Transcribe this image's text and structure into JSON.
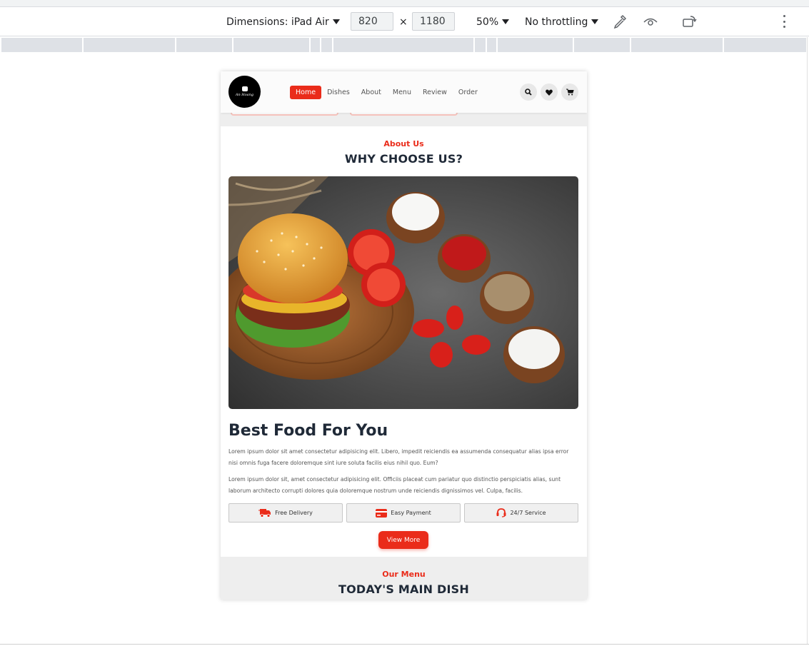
{
  "devtools": {
    "dimensions_label": "Dimensions: iPad Air",
    "width": "820",
    "times": "×",
    "height": "1180",
    "zoom": "50%",
    "throttling": "No throttling"
  },
  "site": {
    "logo_text": "An Hoang",
    "nav": [
      "Home",
      "Dishes",
      "About",
      "Menu",
      "Review",
      "Order"
    ],
    "active_nav": "Home",
    "about": {
      "kicker": "About Us",
      "title": "WHY CHOOSE US?",
      "heading": "Best Food For You",
      "para1": "Lorem ipsum dolor sit amet consectetur adipisicing elit. Libero, impedit reiciendis ea assumenda consequatur alias ipsa error nisi omnis fuga facere doloremque sint iure soluta facilis eius nihil quo. Eum?",
      "para2": "Lorem ipsum dolor sit, amet consectetur adipisicing elit. Officiis placeat cum pariatur quo distinctio perspiciatis alias, sunt laborum architecto corrupti dolores quia doloremque nostrum unde reiciendis dignissimos vel. Culpa, facilis.",
      "features": [
        "Free Delivery",
        "Easy Payment",
        "24/7 Service"
      ],
      "cta": "View More"
    },
    "menu": {
      "kicker": "Our Menu",
      "title": "TODAY'S MAIN DISH"
    }
  },
  "colors": {
    "accent": "#ea2c1a",
    "heading": "#1f2937",
    "toolbar_bg": "#ffffff"
  },
  "icons": [
    "caret-down-icon",
    "eyedropper-icon",
    "eye-icon",
    "rotate-icon",
    "more-vert-icon",
    "search-icon",
    "heart-icon",
    "cart-icon",
    "truck-icon",
    "credit-card-icon",
    "headset-icon"
  ]
}
